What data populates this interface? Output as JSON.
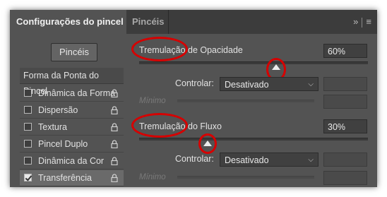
{
  "tabs": {
    "active": "Configurações do pincel",
    "inactive": "Pincéis"
  },
  "tabbar_icons": {
    "collapse": "»",
    "menu": "≡"
  },
  "left": {
    "brushes_button": "Pincéis",
    "brush_tip": "Forma da Ponta do Pincel",
    "options": [
      {
        "label": "Dinâmica da Forma",
        "checked": false,
        "locked": true
      },
      {
        "label": "Dispersão",
        "checked": false,
        "locked": true
      },
      {
        "label": "Textura",
        "checked": false,
        "locked": true
      },
      {
        "label": "Pincel Duplo",
        "checked": false,
        "locked": true
      },
      {
        "label": "Dinâmica da Cor",
        "checked": false,
        "locked": true
      },
      {
        "label": "Transferência",
        "checked": true,
        "locked": true
      }
    ]
  },
  "opacity": {
    "label": "Tremulação de Opacidade",
    "value": "60%",
    "slider_fraction": 0.6,
    "control_label": "Controlar:",
    "control_value": "Desativado",
    "min_label": "Mínimo"
  },
  "flow": {
    "label": "Tremulação do Fluxo",
    "value": "30%",
    "slider_fraction": 0.3,
    "control_label": "Controlar:",
    "control_value": "Desativado",
    "min_label": "Mínimo"
  },
  "colors": {
    "highlight": "#d60000",
    "panel_bg": "#535353"
  }
}
